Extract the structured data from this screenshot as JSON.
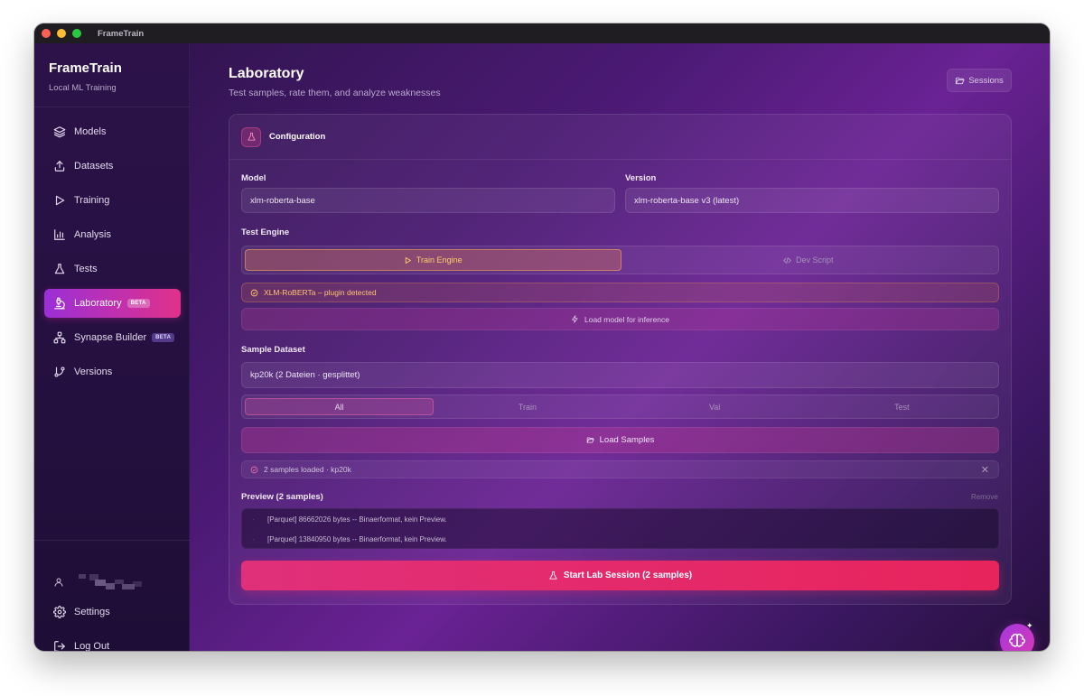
{
  "window": {
    "title": "FrameTrain"
  },
  "brand": {
    "name": "FrameTrain",
    "subtitle": "Local ML Training"
  },
  "nav": [
    {
      "label": "Models",
      "icon": "layers-icon"
    },
    {
      "label": "Datasets",
      "icon": "upload-icon"
    },
    {
      "label": "Training",
      "icon": "play-icon"
    },
    {
      "label": "Analysis",
      "icon": "bar-chart-icon"
    },
    {
      "label": "Tests",
      "icon": "flask-icon"
    },
    {
      "label": "Laboratory",
      "icon": "microscope-icon",
      "badge": "BETA",
      "active": true
    },
    {
      "label": "Synapse Builder",
      "icon": "network-icon",
      "badge": "BETA"
    },
    {
      "label": "Versions",
      "icon": "git-branch-icon"
    }
  ],
  "bottom_nav": [
    {
      "label": "Settings",
      "icon": "gear-icon"
    },
    {
      "label": "Log Out",
      "icon": "logout-icon"
    }
  ],
  "page": {
    "title": "Laboratory",
    "subtitle": "Test samples, rate them, and analyze weaknesses",
    "sessions_label": "Sessions"
  },
  "config": {
    "title": "Configuration",
    "model_label": "Model",
    "model_value": "xlm-roberta-base",
    "version_label": "Version",
    "version_value": "xlm-roberta-base v3 (latest)",
    "engine_label": "Test Engine",
    "engine_options": [
      "Train Engine",
      "Dev Script"
    ],
    "engine_selected": "Train Engine",
    "plugin_status": "XLM-RoBERTa – plugin detected",
    "load_model_label": "Load model for inference",
    "dataset_label": "Sample Dataset",
    "dataset_value": "kp20k (2 Dateien · gesplittet)",
    "splits": [
      "All",
      "Train",
      "Val",
      "Test"
    ],
    "split_selected": "All",
    "load_samples_label": "Load Samples",
    "loaded_status": "2 samples loaded · kp20k",
    "close_glyph": "✕",
    "preview_label": "Preview (2 samples)",
    "remove_label": "Remove",
    "preview_rows": [
      "[Parquet] 86662026 bytes -- Binaerformat, kein Preview.",
      "[Parquet] 13840950 bytes -- Binaerformat, kein Preview."
    ],
    "start_label": "Start Lab Session (2 samples)"
  },
  "colors": {
    "accent": "#e0318a",
    "brand_purple": "#9b2fd6",
    "warning": "#ffc56b"
  }
}
